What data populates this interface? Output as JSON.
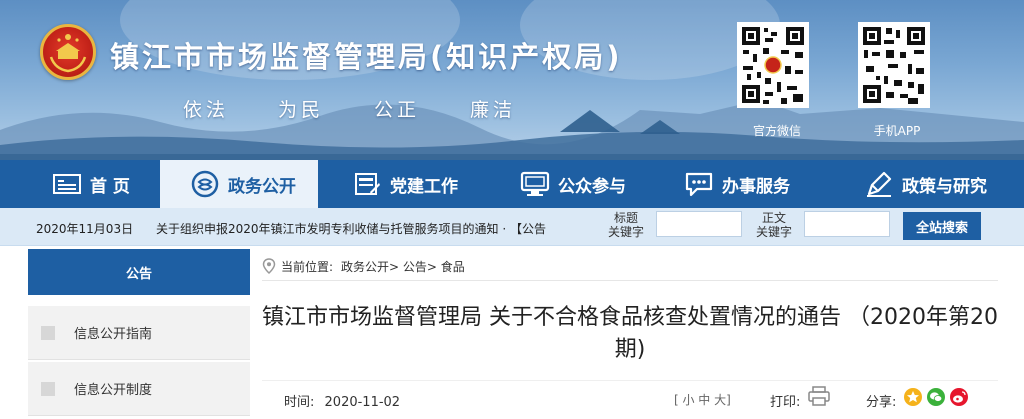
{
  "header": {
    "site_title": "镇江市市场监督管理局(知识产权局)",
    "slogans": [
      "依法",
      "为民",
      "公正",
      "廉洁"
    ],
    "qr_wechat_label": "官方微信",
    "qr_app_label": "手机APP",
    "colors": {
      "banner_top": "#5d8fc3",
      "nav_bg": "#1e5fa3",
      "emblem": "#c5241a"
    }
  },
  "nav": {
    "items": [
      {
        "label": "首 页",
        "icon": "home-icon"
      },
      {
        "label": "政务公开",
        "icon": "chat-bubbles-icon",
        "active": true
      },
      {
        "label": "党建工作",
        "icon": "flag-pen-icon"
      },
      {
        "label": "公众参与",
        "icon": "monitor-icon"
      },
      {
        "label": "办事服务",
        "icon": "speech-bubble-icon"
      },
      {
        "label": "政策与研究",
        "icon": "pen-icon"
      }
    ]
  },
  "strip": {
    "date": "2020年11月03日",
    "news": "关于组织申报2020年镇江市发明专利收储与托管服务项目的通知 · 【公告",
    "title_label_1": "标题",
    "title_label_2": "关键字",
    "body_label_1": "正文",
    "body_label_2": "关键字",
    "title_placeholder": "",
    "body_placeholder": "",
    "search_button": "全站搜索"
  },
  "sidebar": {
    "heading": "公告",
    "items": [
      {
        "label": "信息公开指南"
      },
      {
        "label": "信息公开制度"
      }
    ]
  },
  "breadcrumb": {
    "prefix": "当前位置:",
    "path": "政务公开> 公告> 食品"
  },
  "article": {
    "title": "镇江市市场监督管理局 关于不合格食品核查处置情况的通告 （2020年第20期)",
    "time_label": "时间:",
    "time_value": "2020-11-02",
    "font_size_control": "[ 小 中 大]",
    "print_label": "打印:",
    "share_label": "分享:"
  }
}
